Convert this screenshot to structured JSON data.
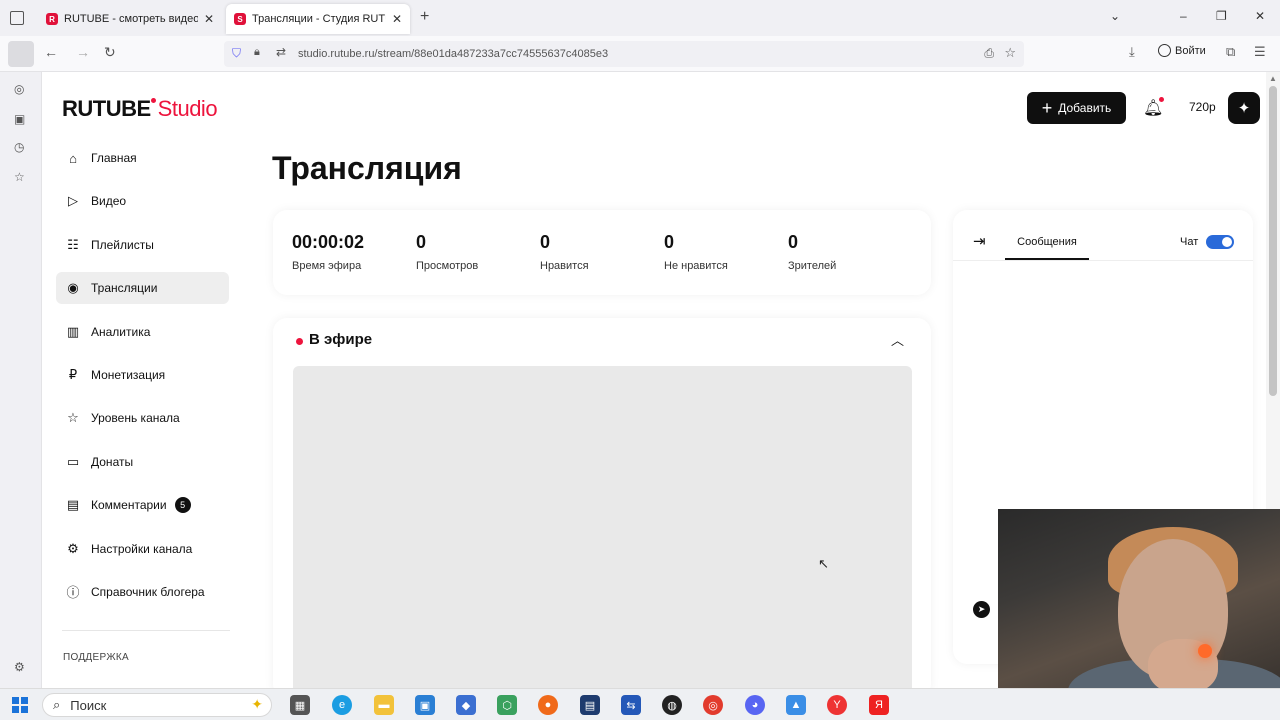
{
  "browser": {
    "tabs": [
      {
        "title": "RUTUBE - смотреть видео онл",
        "active": false
      },
      {
        "title": "Трансляции - Студия RUTUBE",
        "active": true
      }
    ],
    "url": "studio.rutube.ru/stream/88e01da487233a7cc74555637c4085e3",
    "login_label": "Войти"
  },
  "header": {
    "logo_main": "RUTUBE",
    "logo_sub": "Studio",
    "add_button": "Добавить",
    "quality": "720p"
  },
  "sidebar": {
    "items": [
      {
        "label": "Главная",
        "icon": "home-icon",
        "active": false
      },
      {
        "label": "Видео",
        "icon": "video-icon",
        "active": false
      },
      {
        "label": "Плейлисты",
        "icon": "playlist-icon",
        "active": false
      },
      {
        "label": "Трансляции",
        "icon": "broadcast-icon",
        "active": true
      },
      {
        "label": "Аналитика",
        "icon": "analytics-icon",
        "active": false
      },
      {
        "label": "Монетизация",
        "icon": "ruble-icon",
        "active": false
      },
      {
        "label": "Уровень канала",
        "icon": "star-icon",
        "active": false
      },
      {
        "label": "Донаты",
        "icon": "wallet-icon",
        "active": false
      },
      {
        "label": "Комментарии",
        "icon": "comment-icon",
        "active": false,
        "badge": "5"
      },
      {
        "label": "Настройки канала",
        "icon": "gear-icon",
        "active": false
      },
      {
        "label": "Справочник блогера",
        "icon": "info-icon",
        "active": false
      }
    ],
    "support_heading": "ПОДДЕРЖКА"
  },
  "page": {
    "title": "Трансляция"
  },
  "stats": [
    {
      "value": "00:00:02",
      "label": "Время эфира"
    },
    {
      "value": "0",
      "label": "Просмотров"
    },
    {
      "value": "0",
      "label": "Нравится"
    },
    {
      "value": "0",
      "label": "Не нравится"
    },
    {
      "value": "0",
      "label": "Зрителей"
    }
  ],
  "live": {
    "title": "В эфире"
  },
  "chat": {
    "tab_label": "Сообщения",
    "toggle_label": "Чат",
    "toggle_on": true
  },
  "taskbar": {
    "search_placeholder": "Поиск"
  },
  "colors": {
    "brand_red": "#ed143d",
    "toggle_blue": "#2a6ad9"
  }
}
